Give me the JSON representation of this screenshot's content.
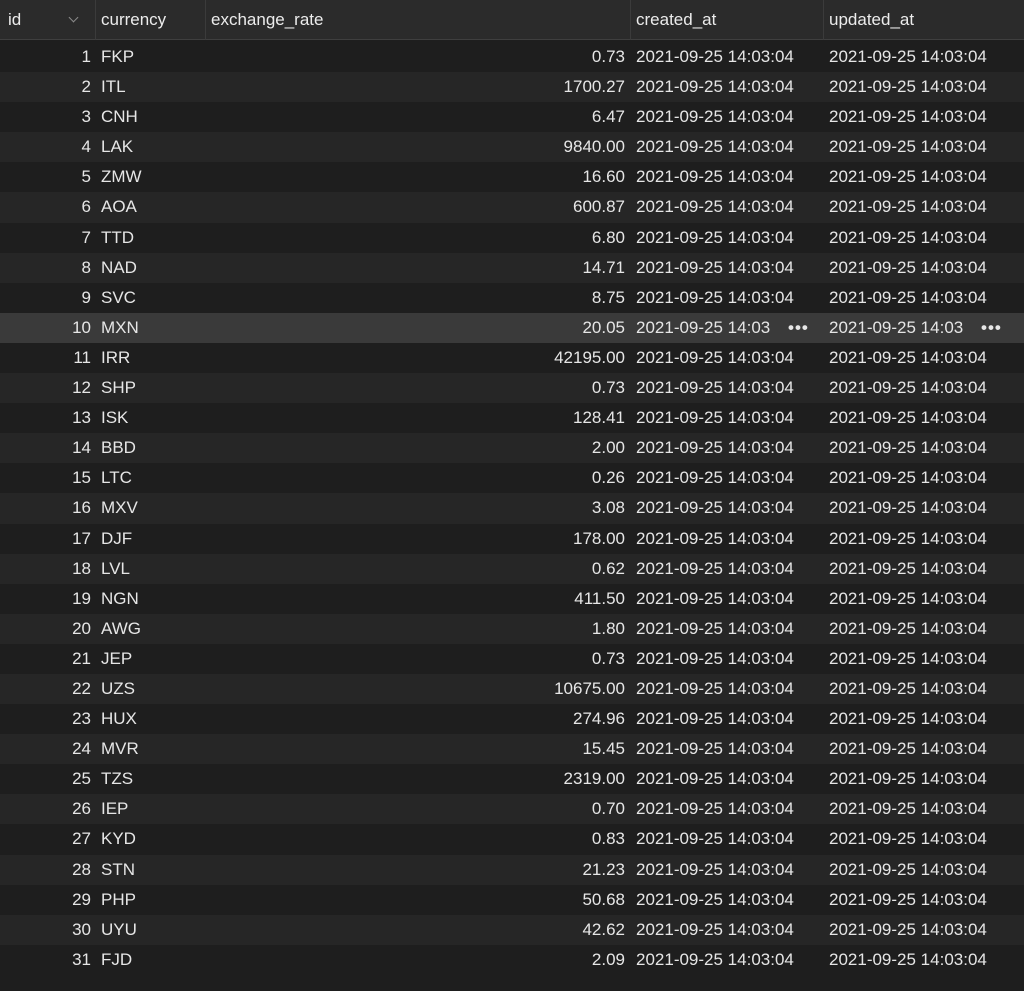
{
  "columns": {
    "id": "id",
    "currency": "currency",
    "exchange_rate": "exchange_rate",
    "created_at": "created_at",
    "updated_at": "updated_at"
  },
  "timestamp_full": "2021-09-25 14:03:04",
  "timestamp_truncated": "2021-09-25 14:03",
  "ellipsis": "•••",
  "selected_row_id": "10",
  "rows": [
    {
      "id": "1",
      "currency": "FKP",
      "exchange_rate": "0.73"
    },
    {
      "id": "2",
      "currency": "ITL",
      "exchange_rate": "1700.27"
    },
    {
      "id": "3",
      "currency": "CNH",
      "exchange_rate": "6.47"
    },
    {
      "id": "4",
      "currency": "LAK",
      "exchange_rate": "9840.00"
    },
    {
      "id": "5",
      "currency": "ZMW",
      "exchange_rate": "16.60"
    },
    {
      "id": "6",
      "currency": "AOA",
      "exchange_rate": "600.87"
    },
    {
      "id": "7",
      "currency": "TTD",
      "exchange_rate": "6.80"
    },
    {
      "id": "8",
      "currency": "NAD",
      "exchange_rate": "14.71"
    },
    {
      "id": "9",
      "currency": "SVC",
      "exchange_rate": "8.75"
    },
    {
      "id": "10",
      "currency": "MXN",
      "exchange_rate": "20.05"
    },
    {
      "id": "11",
      "currency": "IRR",
      "exchange_rate": "42195.00"
    },
    {
      "id": "12",
      "currency": "SHP",
      "exchange_rate": "0.73"
    },
    {
      "id": "13",
      "currency": "ISK",
      "exchange_rate": "128.41"
    },
    {
      "id": "14",
      "currency": "BBD",
      "exchange_rate": "2.00"
    },
    {
      "id": "15",
      "currency": "LTC",
      "exchange_rate": "0.26"
    },
    {
      "id": "16",
      "currency": "MXV",
      "exchange_rate": "3.08"
    },
    {
      "id": "17",
      "currency": "DJF",
      "exchange_rate": "178.00"
    },
    {
      "id": "18",
      "currency": "LVL",
      "exchange_rate": "0.62"
    },
    {
      "id": "19",
      "currency": "NGN",
      "exchange_rate": "411.50"
    },
    {
      "id": "20",
      "currency": "AWG",
      "exchange_rate": "1.80"
    },
    {
      "id": "21",
      "currency": "JEP",
      "exchange_rate": "0.73"
    },
    {
      "id": "22",
      "currency": "UZS",
      "exchange_rate": "10675.00"
    },
    {
      "id": "23",
      "currency": "HUX",
      "exchange_rate": "274.96"
    },
    {
      "id": "24",
      "currency": "MVR",
      "exchange_rate": "15.45"
    },
    {
      "id": "25",
      "currency": "TZS",
      "exchange_rate": "2319.00"
    },
    {
      "id": "26",
      "currency": "IEP",
      "exchange_rate": "0.70"
    },
    {
      "id": "27",
      "currency": "KYD",
      "exchange_rate": "0.83"
    },
    {
      "id": "28",
      "currency": "STN",
      "exchange_rate": "21.23"
    },
    {
      "id": "29",
      "currency": "PHP",
      "exchange_rate": "50.68"
    },
    {
      "id": "30",
      "currency": "UYU",
      "exchange_rate": "42.62"
    },
    {
      "id": "31",
      "currency": "FJD",
      "exchange_rate": "2.09"
    }
  ]
}
